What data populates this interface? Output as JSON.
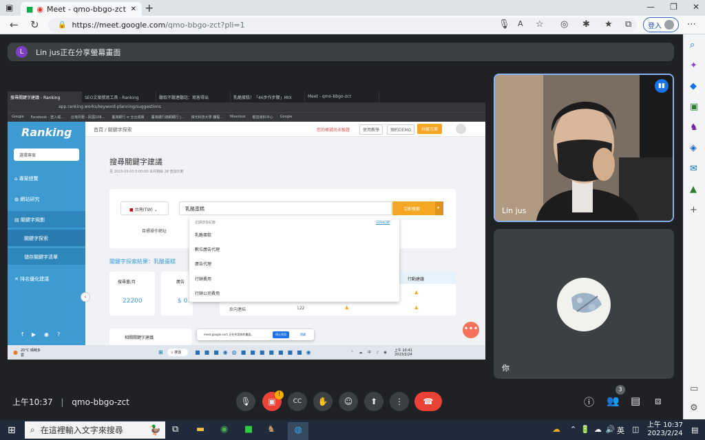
{
  "browser": {
    "tab_title": "Meet - qmo-bbgo-zct",
    "url_host": "https://meet.google.com",
    "url_path": "/qmo-bbgo-zct?pli=1",
    "signin_label": "登入"
  },
  "presenting": {
    "avatar_letter": "L",
    "text": "Lin jus正在分享螢幕畫面"
  },
  "shared_screen": {
    "tabs": [
      "搜尋關鍵字建議 - Ranking",
      "SEO文案撰寫工具 - Ranking",
      "聽取不聽連聽話：寫客得出",
      "乳酪蛋糕！「46步作步驟」MIX",
      "Meet - qmo-bbgo-zct"
    ],
    "address": "app.ranking.works/keyword-planning/suggestions",
    "bookmarks": [
      "Google",
      "Facebook - 登入或...",
      "台灣月曆 - 民國108...",
      "臺灣銀行 ≡ 全台成績",
      "臺灣銀行總網銀行 |...",
      "偉光科技大學 課程...",
      "Mixerbox",
      "觀音資料中心",
      "Google"
    ],
    "brand": "Ranking",
    "project_select": "選擇專案",
    "menu": [
      {
        "label": "專案總覽",
        "icon": "⌂"
      },
      {
        "label": "網站研究",
        "icon": "◍"
      },
      {
        "label": "關鍵字規劃",
        "icon": "▤"
      },
      {
        "label": "關鍵字探索",
        "icon": ""
      },
      {
        "label": "儲存關鍵字清單",
        "icon": ""
      },
      {
        "label": "排名優化建議",
        "icon": "✕"
      }
    ],
    "breadcrumb": "首頁 / 關鍵字探索",
    "warning": "您的帳號尚未驗證",
    "top_btns": [
      "使用教學",
      "預約DEMO",
      "升級方案"
    ],
    "page_title": "搜尋關鍵字建議",
    "subtitle": "至 2023-03-03 0:00:00 本月剩餘 28 查詢次數",
    "region": "台灣(TW)",
    "keyword": "乳酪蛋糕",
    "search_btn": "立即搜索",
    "target_label": "目標操作網址",
    "dropdown_header": "近期搜尋紀錄",
    "dropdown_clear": "清除紀錄",
    "dropdown_items": [
      "乳酪蛋糕",
      "數位廣告代理",
      "廣告代理",
      "行銷費用",
      "行銷公司費用"
    ],
    "result_title": "關鍵字探索結果：乳酪蛋糕",
    "stat_label": "搜尋量/月",
    "stat_value": "22200",
    "stat2_label": "廣告",
    "stat2_value": "$ 0.",
    "col_action": "行動建議",
    "row_label": "反向連結",
    "row_value": "122",
    "related_tab": "相關關鍵字建議",
    "share_notice": "meet.google.com 正在共用你的畫面。",
    "share_stop": "停止共用",
    "share_hide": "隱藏",
    "weather": "20°C 晴時多雲",
    "taskbar_search": "搜尋",
    "clock_time": "上午 10:41",
    "clock_date": "2023/2/24"
  },
  "tiles": {
    "presenter_name": "Lin jus",
    "self_name": "你"
  },
  "bottom": {
    "time": "上午10:37",
    "meeting_code": "qmo-bbgo-zct",
    "people_count": "3",
    "mute_badge": "!"
  },
  "windows": {
    "search_placeholder": "在這裡輸入文字來搜尋",
    "time": "上午 10:37",
    "date": "2023/2/24",
    "lang": "英"
  },
  "colors": {
    "meet_bg": "#202124",
    "end_call": "#ea4335",
    "ranking_blue": "#3d9bd1",
    "ranking_orange": "#f5a623"
  }
}
